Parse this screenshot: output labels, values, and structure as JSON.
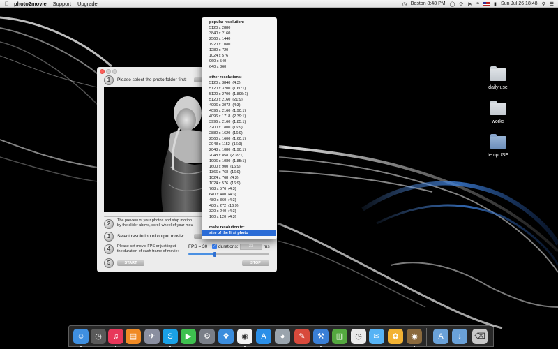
{
  "menubar": {
    "app_name": "photo2movie",
    "menus": [
      "Support",
      "Upgrade"
    ],
    "location_time": "Boston 8:48 PM",
    "clock": "Sun Jul 26  18:48"
  },
  "desktop_icons": [
    {
      "label": "daily use"
    },
    {
      "label": "works"
    },
    {
      "label": "tempUSE"
    }
  ],
  "app": {
    "step1_label": "Please select the photo folder first:",
    "step2_text_line1": "The preview of your photos and stop motion",
    "step2_text_line2": "by the slider above, scroll wheel of your mou",
    "step3_label": "Select resolution of output movie:",
    "step4_text_line1": "Please set movie FPS or just input",
    "step4_text_line2": "the duration of each frame of movie:",
    "fps_label": "FPS = 30",
    "duration_label": "durations:",
    "duration_value": "33",
    "duration_unit": "ms",
    "start_button": "START",
    "stop_button": "STOP",
    "step_numbers": [
      "1",
      "2",
      "3",
      "4",
      "5"
    ],
    "fps_slider_value": 0.33
  },
  "resolution_dropdown": {
    "popular_header": "popular resolution:",
    "popular": [
      "5120 x 2880",
      "3840 x 2160",
      "2560 x 1440",
      "1920 x 1080",
      "1280 x 720",
      "1024 x 576",
      "960 x 540",
      "640 x 360"
    ],
    "other_header": "other resolutions:",
    "other": [
      "5120 x 3840  (4:3)",
      "5120 x 3200  (1.60:1)",
      "5120 x 2700  (1.896:1)",
      "5120 x 2160  (21:9)",
      "4096 x 3072  (4:3)",
      "4096 x 2160  (1.90:1)",
      "4096 x 1718  (2.39:1)",
      "3996 x 2160  (1.85:1)",
      "3200 x 1800  (16:9)",
      "2880 x 1620  (16:9)",
      "2560 x 1600  (1.60:1)",
      "2048 x 1152  (16:9)",
      "2048 x 1080  (1.90:1)",
      "2048 x 858  (2.39:1)",
      "1996 x 1080  (1.85:1)",
      "1600 x 900  (16:9)",
      "1366 x 768  (16:9)",
      "1024 x 768  (4:3)",
      "1024 x 576  (16:9)",
      "768 x 576  (4:3)",
      "640 x 480  (4:3)",
      "480 x 360  (4:3)",
      "480 x 272  (16:9)",
      "320 x 240  (4:3)",
      "160 x 120  (4:3)"
    ],
    "make_header": "make resolution to:",
    "selected": "size of the first photo"
  },
  "dock": {
    "icons": [
      "finder-icon",
      "dashboard-icon",
      "itunes-icon",
      "ibooks-icon",
      "launchpad-icon",
      "skype-icon",
      "facetime-icon",
      "system-preferences-icon",
      "safari-icon",
      "chrome-icon",
      "app-store-icon",
      "disk-utility-icon",
      "preview-icon",
      "xcode-icon",
      "numbers-icon",
      "clock-icon",
      "messages-icon",
      "photos-icon",
      "photo2movie-icon",
      "applications-folder-icon",
      "downloads-folder-icon",
      "trash-icon"
    ]
  }
}
